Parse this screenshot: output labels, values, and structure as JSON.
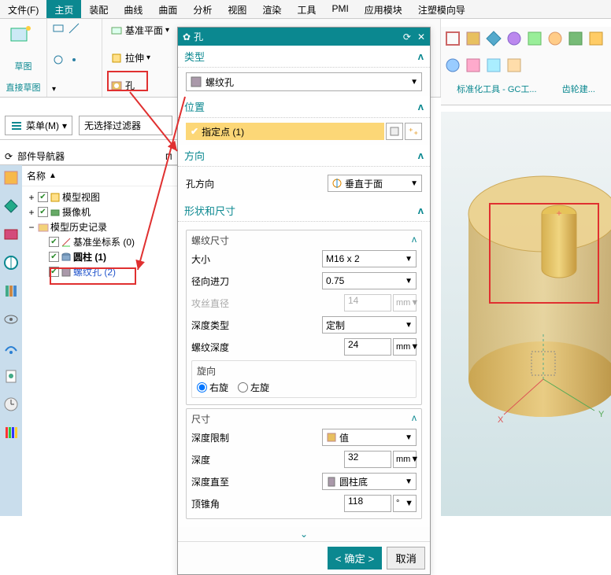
{
  "menu": {
    "file": "文件(F)",
    "tabs": [
      "主页",
      "装配",
      "曲线",
      "曲面",
      "分析",
      "视图",
      "渲染",
      "工具",
      "PMI",
      "应用模块",
      "注塑模向导"
    ],
    "active": 0
  },
  "ribbon": {
    "sketch": "草图",
    "direct": "直接草图",
    "datum": "基准平面",
    "extrude": "拉伸",
    "hole": "孔"
  },
  "rightRibbon": {
    "lbl1": "标准化工具 - GC工...",
    "lbl2": "齿轮建..."
  },
  "toolbar": {
    "menu": "菜单(M)",
    "filter": "无选择过滤器"
  },
  "nav": {
    "title": "部件导航器",
    "col": "名称",
    "items": {
      "modelView": "模型视图",
      "camera": "摄像机",
      "history": "模型历史记录",
      "datumCsys": "基准坐标系 (0)",
      "cylinder": "圆柱 (1)",
      "threadHole": "螺纹孔 (2)"
    }
  },
  "dialog": {
    "title": "孔",
    "sections": {
      "type": "类型",
      "typeSel": "螺纹孔",
      "position": "位置",
      "point": "指定点 (1)",
      "direction": "方向",
      "holeDir": "孔方向",
      "holeDirVal": "垂直于面",
      "shape": "形状和尺寸",
      "threadDim": "螺纹尺寸",
      "size": "大小",
      "sizeVal": "M16 x 2",
      "radial": "径向进刀",
      "radialVal": "0.75",
      "tapDia": "攻丝直径",
      "tapDiaVal": "14",
      "depthType": "深度类型",
      "depthTypeVal": "定制",
      "threadDepth": "螺纹深度",
      "threadDepthVal": "24",
      "rotation": "旋向",
      "right": "右旋",
      "left": "左旋",
      "dim": "尺寸",
      "depthLimit": "深度限制",
      "depthLimitVal": "值",
      "depth": "深度",
      "depthVal": "32",
      "depthTo": "深度直至",
      "depthToVal": "圆柱底",
      "tipAngle": "顶锥角",
      "tipAngleVal": "118",
      "mm": "mm",
      "deg": "°"
    },
    "btns": {
      "ok": "< 确定 >",
      "cancel": "取消"
    }
  },
  "colors": {
    "teal": "#0b8890",
    "selYellow": "#fcd777",
    "red": "#e03030",
    "link": "#2255cc"
  }
}
